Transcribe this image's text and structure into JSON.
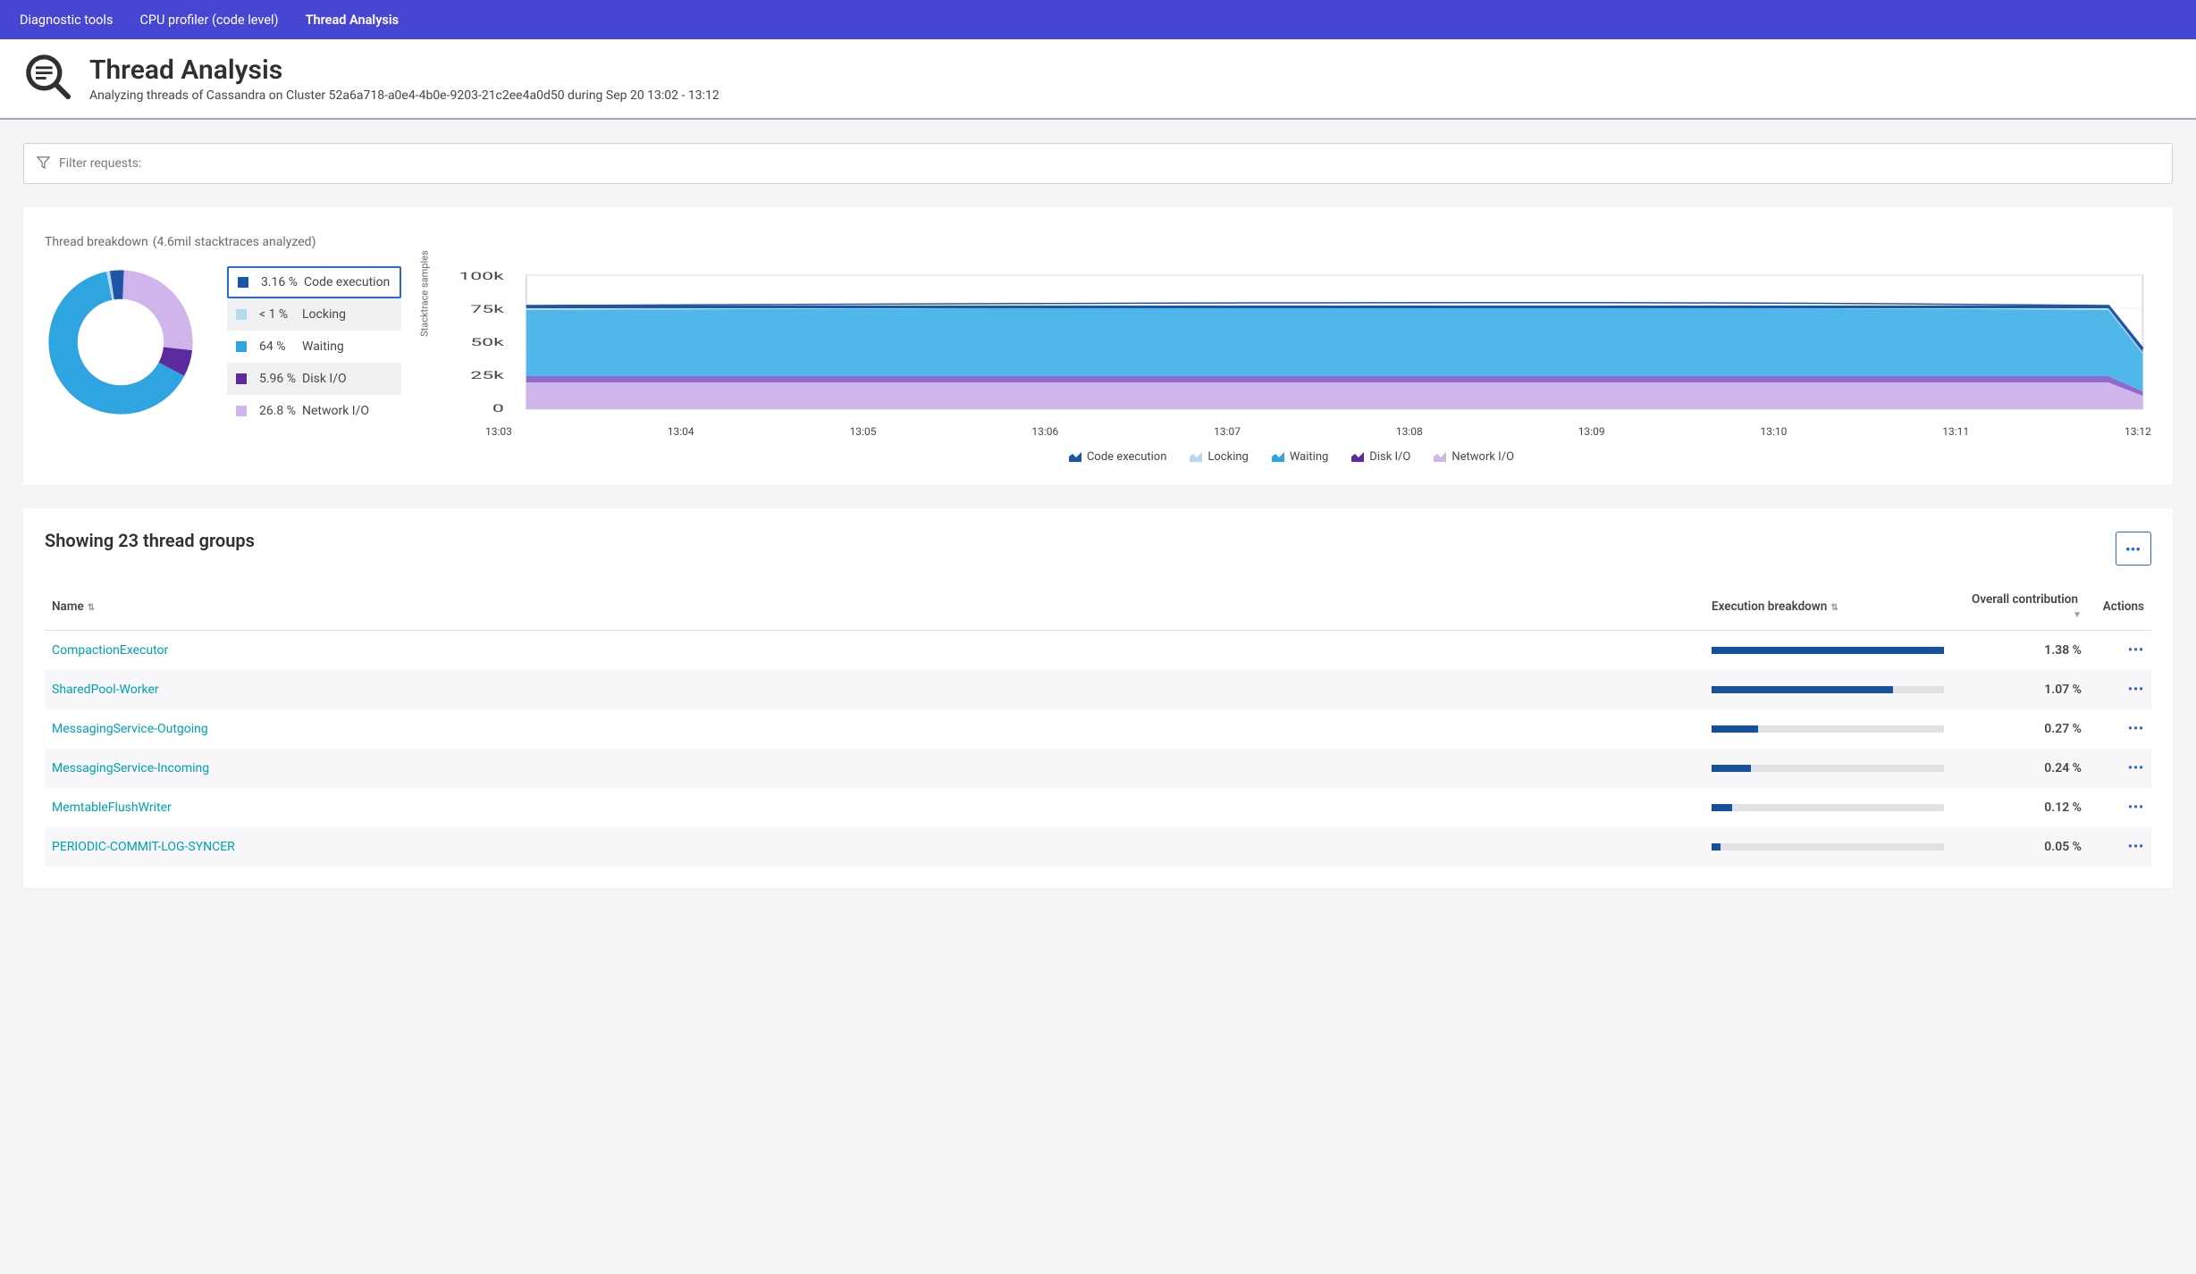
{
  "breadcrumb": [
    "Diagnostic tools",
    "CPU profiler (code level)",
    "Thread Analysis"
  ],
  "page": {
    "title": "Thread Analysis",
    "subtitle": "Analyzing threads of Cassandra on Cluster 52a6a718-a0e4-4b0e-9203-21c2ee4a0d50 during Sep 20 13:02 - 13:12"
  },
  "filter": {
    "placeholder": "Filter requests:"
  },
  "breakdown": {
    "title": "Thread breakdown",
    "subtitle": "(4.6mil stacktraces analyzed)",
    "legend": [
      {
        "pct": "3.16 %",
        "label": "Code execution",
        "color": "#1f55a5",
        "selected": true
      },
      {
        "pct": "< 1 %",
        "label": "Locking",
        "color": "#b4d9ee"
      },
      {
        "pct": "64 %",
        "label": "Waiting",
        "color": "#2ea4e0"
      },
      {
        "pct": "5.96 %",
        "label": "Disk I/O",
        "color": "#5a2a9e"
      },
      {
        "pct": "26.8 %",
        "label": "Network I/O",
        "color": "#d0b4ec"
      }
    ],
    "area_yaxis": "Stacktrace samples",
    "area_xticks": [
      "13:03",
      "13:04",
      "13:05",
      "13:06",
      "13:07",
      "13:08",
      "13:09",
      "13:10",
      "13:11",
      "13:12"
    ],
    "bottom_legend": [
      {
        "label": "Code execution",
        "color": "#1f55a5"
      },
      {
        "label": "Locking",
        "color": "#b4d9ee"
      },
      {
        "label": "Waiting",
        "color": "#2ea4e0"
      },
      {
        "label": "Disk I/O",
        "color": "#5a2a9e"
      },
      {
        "label": "Network I/O",
        "color": "#d0b4ec"
      }
    ]
  },
  "table": {
    "title": "Showing 23 thread groups",
    "columns": {
      "name": "Name",
      "exec": "Execution breakdown",
      "overall": "Overall contribution",
      "actions": "Actions"
    },
    "rows": [
      {
        "name": "CompactionExecutor",
        "bar": 100,
        "overall": "1.38 %"
      },
      {
        "name": "SharedPool-Worker",
        "bar": 78,
        "overall": "1.07 %"
      },
      {
        "name": "MessagingService-Outgoing",
        "bar": 20,
        "overall": "0.27 %"
      },
      {
        "name": "MessagingService-Incoming",
        "bar": 17,
        "overall": "0.24 %"
      },
      {
        "name": "MemtableFlushWriter",
        "bar": 9,
        "overall": "0.12 %"
      },
      {
        "name": "PERIODIC-COMMIT-LOG-SYNCER",
        "bar": 4,
        "overall": "0.05 %"
      }
    ]
  },
  "chart_data": [
    {
      "type": "pie",
      "title": "Thread breakdown",
      "series": [
        {
          "name": "Code execution",
          "value": 3.16,
          "color": "#1f55a5"
        },
        {
          "name": "Locking",
          "value": 0.8,
          "color": "#b4d9ee"
        },
        {
          "name": "Waiting",
          "value": 64.0,
          "color": "#2ea4e0"
        },
        {
          "name": "Disk I/O",
          "value": 5.96,
          "color": "#5a2a9e"
        },
        {
          "name": "Network I/O",
          "value": 26.8,
          "color": "#d0b4ec"
        }
      ]
    },
    {
      "type": "area",
      "title": "Stacktrace samples over time",
      "ylabel": "Stacktrace samples",
      "xlabel": "",
      "ylim": [
        0,
        100000
      ],
      "yticks": [
        0,
        25000,
        50000,
        75000,
        100000
      ],
      "x": [
        "13:02",
        "13:03",
        "13:04",
        "13:05",
        "13:06",
        "13:07",
        "13:08",
        "13:09",
        "13:10",
        "13:11",
        "13:12"
      ],
      "series": [
        {
          "name": "Network I/O",
          "color": "#d0b4ec",
          "values": [
            20000,
            20000,
            20000,
            20000,
            20000,
            20000,
            20000,
            20000,
            20000,
            20000,
            10000
          ]
        },
        {
          "name": "Disk I/O",
          "color": "#5a2a9e",
          "values": [
            4500,
            4500,
            4500,
            4500,
            4500,
            4500,
            4500,
            4500,
            4500,
            4500,
            2500
          ]
        },
        {
          "name": "Waiting",
          "color": "#2ea4e0",
          "values": [
            48000,
            48000,
            48000,
            49000,
            49000,
            50000,
            49000,
            49000,
            49000,
            49000,
            28000
          ]
        },
        {
          "name": "Locking",
          "color": "#b4d9ee",
          "values": [
            600,
            600,
            600,
            600,
            600,
            600,
            600,
            600,
            600,
            600,
            400
          ]
        },
        {
          "name": "Code execution",
          "color": "#1f55a5",
          "values": [
            2400,
            2400,
            2400,
            2400,
            2400,
            2400,
            2400,
            2400,
            2400,
            2400,
            1500
          ]
        }
      ],
      "stack_totals": [
        75500,
        75500,
        75500,
        76500,
        76500,
        77500,
        76500,
        76500,
        76500,
        76500,
        42400
      ]
    },
    {
      "type": "bar",
      "title": "Thread groups overall contribution",
      "xlabel": "Overall contribution (%)",
      "categories": [
        "CompactionExecutor",
        "SharedPool-Worker",
        "MessagingService-Outgoing",
        "MessagingService-Incoming",
        "MemtableFlushWriter",
        "PERIODIC-COMMIT-LOG-SYNCER"
      ],
      "values": [
        1.38,
        1.07,
        0.27,
        0.24,
        0.12,
        0.05
      ],
      "xlim": [
        0,
        1.38
      ]
    }
  ]
}
